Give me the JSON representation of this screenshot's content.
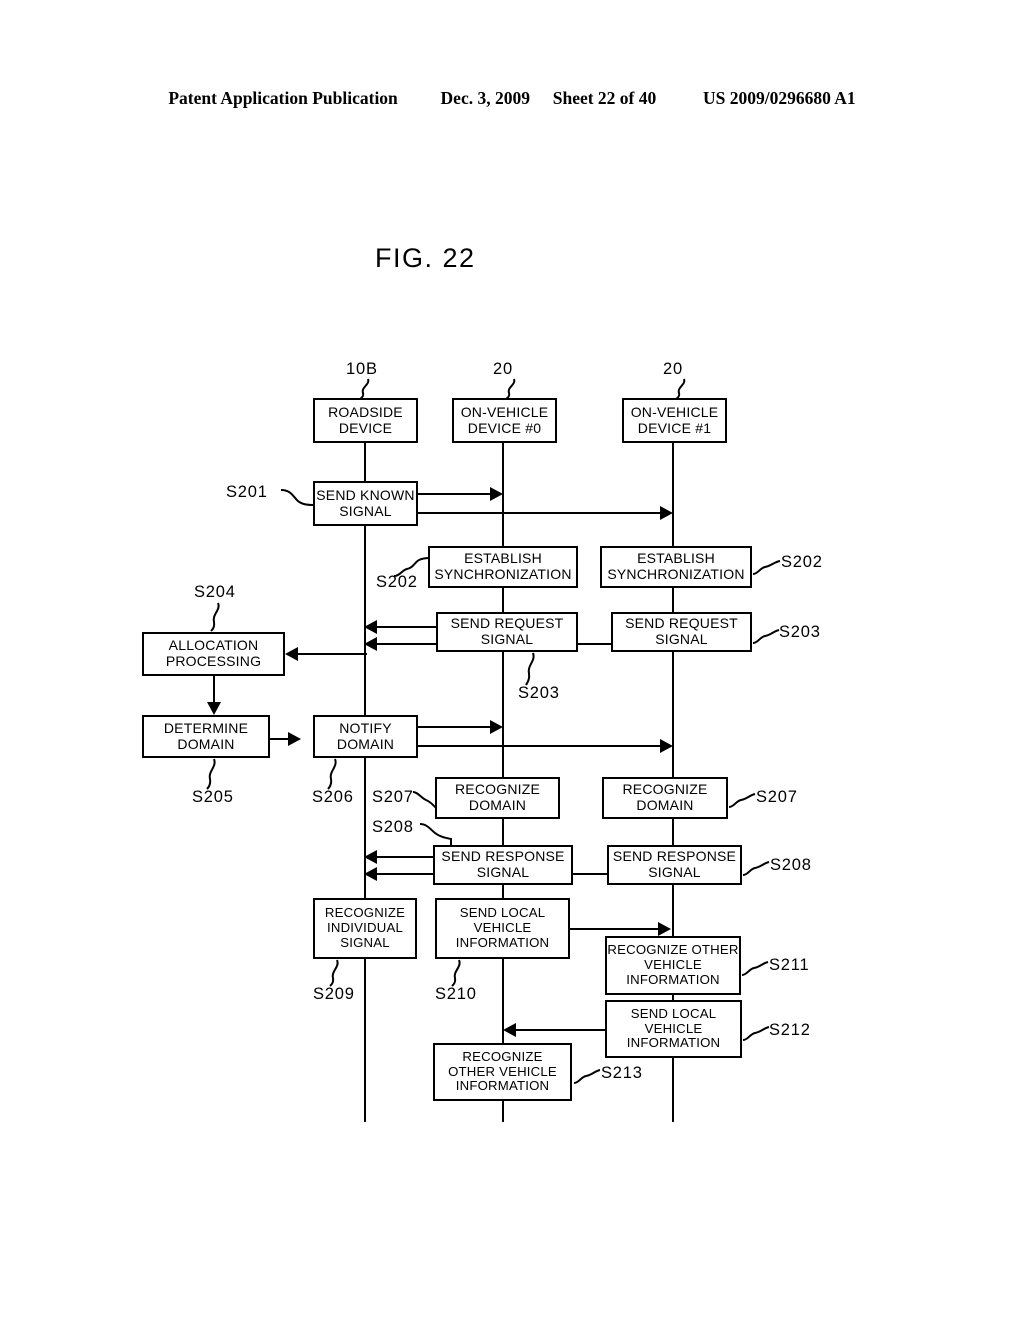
{
  "header": {
    "publication": "Patent Application Publication",
    "date": "Dec. 3, 2009",
    "sheet": "Sheet 22 of 40",
    "patent_number": "US 2009/0296680 A1"
  },
  "figure": {
    "title": "FIG. 22"
  },
  "lanes": [
    {
      "id": "roadside",
      "reference": "10B",
      "line1": "ROADSIDE",
      "line2": "DEVICE"
    },
    {
      "id": "onvehicle0",
      "reference": "20",
      "line1": "ON-VEHICLE",
      "line2": "DEVICE #0"
    },
    {
      "id": "onvehicle1",
      "reference": "20",
      "line1": "ON-VEHICLE",
      "line2": "DEVICE #1"
    }
  ],
  "steps": {
    "s201": {
      "label": "S201",
      "line1": "SEND KNOWN",
      "line2": "SIGNAL"
    },
    "s202_a": {
      "label": "S202",
      "line1": "ESTABLISH",
      "line2": "SYNCHRONIZATION"
    },
    "s202_b": {
      "label": "S202",
      "line1": "ESTABLISH",
      "line2": "SYNCHRONIZATION"
    },
    "s203_a": {
      "label": "S203",
      "line1": "SEND REQUEST",
      "line2": "SIGNAL"
    },
    "s203_b": {
      "label": "S203",
      "line1": "SEND REQUEST",
      "line2": "SIGNAL"
    },
    "s204": {
      "label": "S204",
      "line1": "ALLOCATION",
      "line2": "PROCESSING"
    },
    "s205": {
      "label": "S205",
      "line1": "DETERMINE",
      "line2": "DOMAIN"
    },
    "s206": {
      "label": "S206",
      "line1": "NOTIFY",
      "line2": "DOMAIN"
    },
    "s207_a": {
      "label": "S207",
      "line1": "RECOGNIZE",
      "line2": "DOMAIN"
    },
    "s207_b": {
      "label": "S207",
      "line1": "RECOGNIZE",
      "line2": "DOMAIN"
    },
    "s208_a": {
      "label": "S208",
      "line1": "SEND RESPONSE",
      "line2": "SIGNAL"
    },
    "s208_b": {
      "label": "S208",
      "line1": "SEND RESPONSE",
      "line2": "SIGNAL"
    },
    "s209": {
      "label": "S209",
      "line1": "RECOGNIZE",
      "line2": "INDIVIDUAL",
      "line3": "SIGNAL"
    },
    "s210": {
      "label": "S210",
      "line1": "SEND LOCAL",
      "line2": "VEHICLE",
      "line3": "INFORMATION"
    },
    "s211": {
      "label": "S211",
      "line1": "RECOGNIZE OTHER",
      "line2": "VEHICLE",
      "line3": "INFORMATION"
    },
    "s212": {
      "label": "S212",
      "line1": "SEND LOCAL",
      "line2": "VEHICLE",
      "line3": "INFORMATION"
    },
    "s213": {
      "label": "S213",
      "line1": "RECOGNIZE",
      "line2": "OTHER VEHICLE",
      "line3": "INFORMATION"
    }
  },
  "colors": {
    "ink": "#000000",
    "paper": "#ffffff"
  }
}
